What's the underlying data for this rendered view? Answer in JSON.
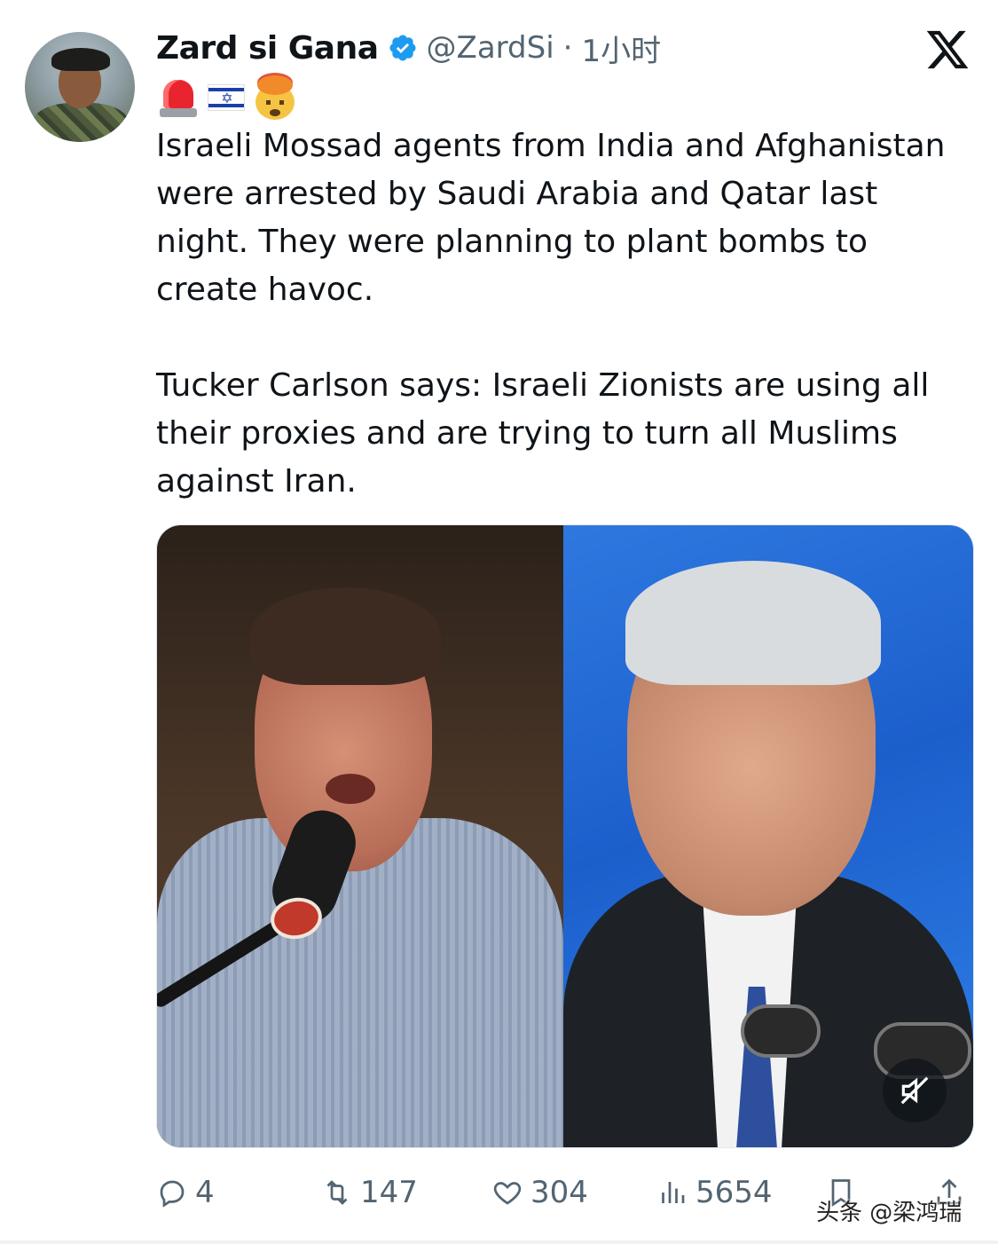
{
  "author": {
    "display_name": "Zard si Gana",
    "handle": "@ZardSi",
    "separator": "·",
    "time": "1小时",
    "verified": true
  },
  "icons": {
    "platform": "x-logo-icon",
    "verified": "verified-badge-icon",
    "emoji": [
      "police-siren-emoji",
      "israel-flag-emoji",
      "exploding-head-emoji"
    ],
    "mute": "mute-icon"
  },
  "tweet": {
    "paragraphs": [
      "Israeli Mossad agents from India and Afghanistan were arrested by Saudi Arabia and Qatar last night. They were planning to plant bombs to create havoc.",
      "Tucker Carlson says: Israeli Zionists are using all their proxies and are trying to turn all Muslims against Iran."
    ]
  },
  "actions": {
    "replies": "4",
    "retweets": "147",
    "likes": "304",
    "views": "5654"
  },
  "watermark": "头条 @梁鸿瑞",
  "colors": {
    "verified_blue": "#1d9bf0",
    "muted_text": "#536471",
    "text": "#0f1419"
  }
}
